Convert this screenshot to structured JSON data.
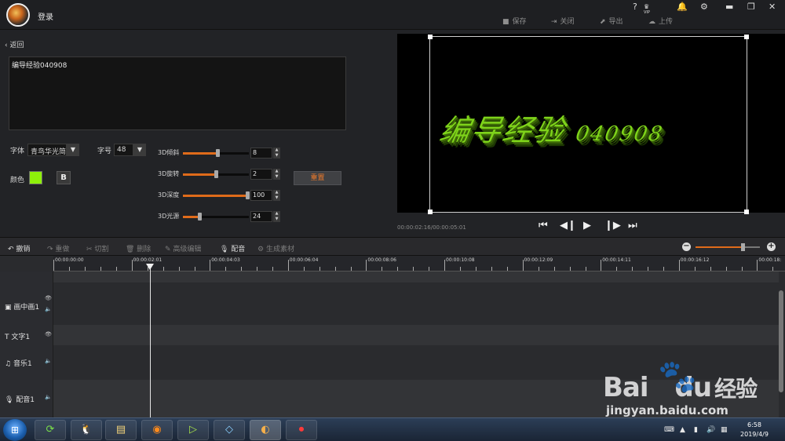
{
  "titlebar": {
    "login": "登录",
    "help": "?",
    "vip": "VIP",
    "actions": {
      "save": "保存",
      "close": "关闭",
      "export": "导出",
      "upload": "上传"
    }
  },
  "editor": {
    "back": "返回",
    "text_value": "编导经验040908",
    "font_label": "字体",
    "font_value": "青鸟华光简行",
    "size_label": "字号",
    "size_value": "48",
    "color_label": "颜色",
    "color_value": "#8ef00a",
    "bold_label": "B",
    "reset_label": "重置",
    "params": [
      {
        "label": "3D倾斜",
        "value": "8",
        "fraction": 0.52
      },
      {
        "label": "3D旋转",
        "value": "2",
        "fraction": 0.5
      },
      {
        "label": "3D深度",
        "value": "100",
        "fraction": 0.98
      },
      {
        "label": "3D光源",
        "value": "24",
        "fraction": 0.25
      }
    ]
  },
  "preview": {
    "text_main": "编导经验",
    "text_num": "040908",
    "timecode": "00:00:02:16/00:00:05:01",
    "text_color": "#7ed31a"
  },
  "toolbar": {
    "undo": "撤销",
    "redo": "重做",
    "cut": "切割",
    "delete": "删除",
    "advanced": "高级编辑",
    "dub": "配音",
    "generate": "生成素材",
    "zoom_fraction": 0.73
  },
  "timeline": {
    "ruler": [
      "00:00:00:00",
      "00:00:02:01",
      "00:00:04:03",
      "00:00:06:04",
      "00:00:08:06",
      "00:00:10:08",
      "00:00:12:09",
      "00:00:14:11",
      "00:00:16:12",
      "00:00:18:"
    ],
    "tracks": [
      {
        "name": "画中画1",
        "icon": "pip-icon"
      },
      {
        "name": "文字1",
        "icon": "text-icon"
      },
      {
        "name": "音乐1",
        "icon": "music-icon"
      },
      {
        "name": "配音1",
        "icon": "mic-icon"
      }
    ]
  },
  "taskbar": {
    "time": "6:58",
    "date": "2019/4/9"
  },
  "watermark": {
    "brand": "Bai",
    "brand2": "du",
    "brand_cn": "经验",
    "url": "jingyan.baidu.com"
  },
  "colors": {
    "accent": "#e06b1a",
    "reset_text": "#ee7a2a"
  }
}
